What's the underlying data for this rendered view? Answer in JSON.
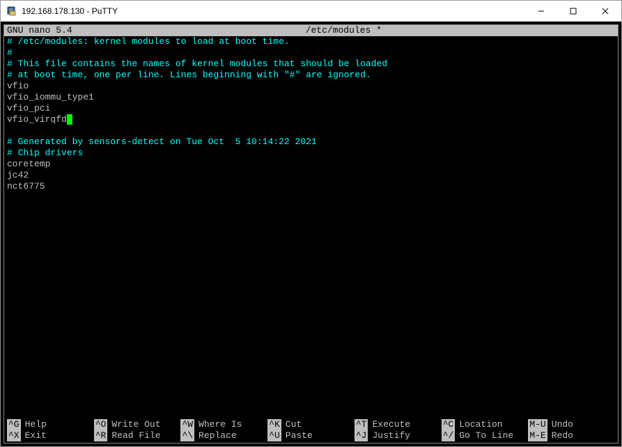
{
  "window": {
    "title": "192.168.178.130 - PuTTY"
  },
  "nano": {
    "app_version": "GNU nano 5.4",
    "file_title": "/etc/modules *"
  },
  "content": {
    "lines": [
      {
        "text": "# /etc/modules: kernel modules to load at boot time.",
        "type": "comment",
        "cursor": false
      },
      {
        "text": "#",
        "type": "comment",
        "cursor": false
      },
      {
        "text": "# This file contains the names of kernel modules that should be loaded",
        "type": "comment",
        "cursor": false
      },
      {
        "text": "# at boot time, one per line. Lines beginning with \"#\" are ignored.",
        "type": "comment",
        "cursor": false
      },
      {
        "text": "vfio",
        "type": "plain",
        "cursor": false
      },
      {
        "text": "vfio_iommu_type1",
        "type": "plain",
        "cursor": false
      },
      {
        "text": "vfio_pci",
        "type": "plain",
        "cursor": false
      },
      {
        "text": "vfio_virqfd",
        "type": "plain",
        "cursor": true
      },
      {
        "text": "",
        "type": "plain",
        "cursor": false
      },
      {
        "text": "# Generated by sensors-detect on Tue Oct  5 10:14:22 2021",
        "type": "comment",
        "cursor": false
      },
      {
        "text": "# Chip drivers",
        "type": "comment",
        "cursor": false
      },
      {
        "text": "coretemp",
        "type": "plain",
        "cursor": false
      },
      {
        "text": "jc42",
        "type": "plain",
        "cursor": false
      },
      {
        "text": "nct6775",
        "type": "plain",
        "cursor": false
      }
    ]
  },
  "shortcuts": {
    "row1": [
      {
        "key": "^G",
        "desc": "Help"
      },
      {
        "key": "^O",
        "desc": "Write Out"
      },
      {
        "key": "^W",
        "desc": "Where Is"
      },
      {
        "key": "^K",
        "desc": "Cut"
      },
      {
        "key": "^T",
        "desc": "Execute"
      },
      {
        "key": "^C",
        "desc": "Location"
      },
      {
        "key": "M-U",
        "desc": "Undo"
      }
    ],
    "row2": [
      {
        "key": "^X",
        "desc": "Exit"
      },
      {
        "key": "^R",
        "desc": "Read File"
      },
      {
        "key": "^\\",
        "desc": "Replace"
      },
      {
        "key": "^U",
        "desc": "Paste"
      },
      {
        "key": "^J",
        "desc": "Justify"
      },
      {
        "key": "^/",
        "desc": "Go To Line"
      },
      {
        "key": "M-E",
        "desc": "Redo"
      }
    ]
  }
}
